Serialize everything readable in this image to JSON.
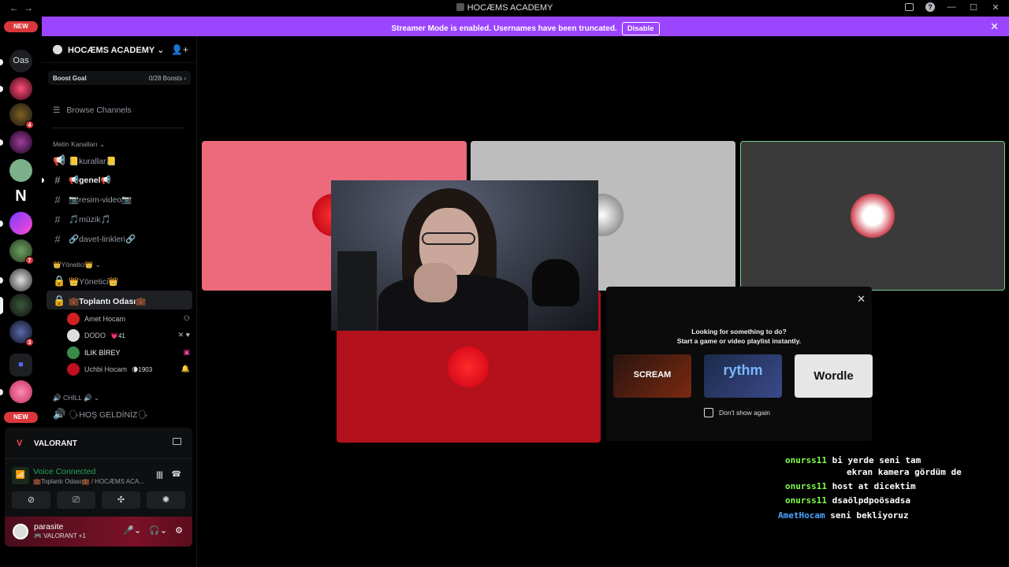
{
  "titlebar": {
    "title": "HOCÆMS ACADEMY"
  },
  "rail": {
    "new_top": "NEW",
    "new_bottom": "NEW",
    "text_server": "Oas",
    "badges": [
      "4",
      "7",
      "3"
    ]
  },
  "banner": {
    "message": "Streamer Mode is enabled. Usernames have been truncated.",
    "button": "Disable"
  },
  "server": {
    "name": "HOCÆMS ACADEMY",
    "boost_label": "Boost Goal",
    "boost_value": "0/28 Boosts",
    "browse": "Browse Channels",
    "categories": [
      "Metin Kanalları",
      "👑Yönetici👑",
      "🔊 CHİLL 🔊"
    ],
    "channels": [
      {
        "label": "📒kurallar📒"
      },
      {
        "label": "📢genel📢"
      },
      {
        "label": "📷resim-video📷"
      },
      {
        "label": "🎵müzik🎵"
      },
      {
        "label": "🔗davet-linkleri🔗"
      },
      {
        "label": "👑Yönetici👑"
      },
      {
        "label": "💼Toplantı Odası💼"
      },
      {
        "label": "🗣HOŞ GELDİNİZ🗣"
      }
    ],
    "voice_users": [
      {
        "name": "Amet Hocam",
        "extra": ""
      },
      {
        "name": "DODO",
        "extra": "💗41"
      },
      {
        "name": "ILIK BİREY",
        "extra": ""
      },
      {
        "name": "Uchbi Hocam",
        "extra": "🌘1903"
      }
    ]
  },
  "panel": {
    "activity": "VALORANT",
    "voice_status": "Voice Connected",
    "voice_channel": "💼Toplantı Odası💼 / HOCÆMS ACA...",
    "username": "parasite",
    "user_status": "🎮 VALORANT +1"
  },
  "activity_card": {
    "line1": "Looking for something to do?",
    "line2": "Start a game or video playlist instantly.",
    "games": [
      {
        "name": "SCREAM",
        "color": "#1a0f0d"
      },
      {
        "name": "rythm",
        "color": "#1b2a4a"
      },
      {
        "name": "Wordle",
        "color": "#e6e6e6"
      }
    ],
    "dont_show": "Don't show again"
  },
  "chat": [
    {
      "nick": "onurss11",
      "text": "bi yerde seni tam"
    },
    {
      "nick": "",
      "text": "ekran kamera gördüm de"
    },
    {
      "nick": "onurss11",
      "text": "host at dicektim"
    },
    {
      "nick": "onurss11",
      "text": "dsaölpdpoösadsa"
    },
    {
      "nick": "AmetHocam",
      "text": "seni bekliyoruz"
    }
  ],
  "colors": {
    "accent_banner": "#9b45ff",
    "tile_pink": "#ec6a7c",
    "tile_gray": "#bdbdbd",
    "tile_dark": "#3a3a3a",
    "tile_red": "#b3111c",
    "voice_green": "#23a55a"
  }
}
